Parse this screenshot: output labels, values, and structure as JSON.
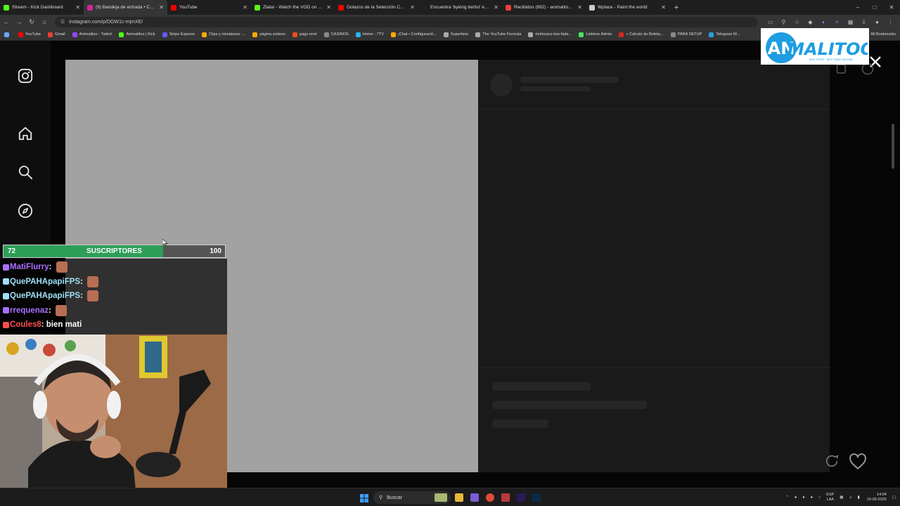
{
  "browser": {
    "tabs": [
      {
        "title": "Stream - Kick Dashboard",
        "color": "#53fc18",
        "active": false
      },
      {
        "title": "(9) Bandeja de entrada • Chats",
        "color": "#d6249f",
        "active": true
      },
      {
        "title": "YouTube",
        "color": "#ff0000",
        "active": false
      },
      {
        "title": "Zlatar - Watch the VOD on Kick",
        "color": "#53fc18",
        "active": false
      },
      {
        "title": "Golazos de la Selección Chilena",
        "color": "#ff0000",
        "active": false
      },
      {
        "title": "Encuentra 'byking tierlist' en TikTok",
        "color": "#222222",
        "active": false
      },
      {
        "title": "Recibidos (892) - animalitoo.stream",
        "color": "#ea4335",
        "active": false
      },
      {
        "title": "Wplace - Paint the world",
        "color": "#cccccc",
        "active": false
      }
    ],
    "new_tab": "+",
    "url": "instagram.com/p/DOW1c-mjmXE/",
    "bookmarks": [
      {
        "label": "YouTube",
        "color": "#ff0000"
      },
      {
        "label": "Gmail",
        "color": "#ea4335"
      },
      {
        "label": "Animalitoo - Twitch",
        "color": "#9146ff"
      },
      {
        "label": "Animalitoo | Kick",
        "color": "#53fc18"
      },
      {
        "label": "Stripe Express",
        "color": "#635bff"
      },
      {
        "label": "Clips y miniaturas -...",
        "color": "#f9ab00"
      },
      {
        "label": "página sorteos",
        "color": "#f9ab00"
      },
      {
        "label": "pago enel",
        "color": "#e94e1b"
      },
      {
        "label": "CASINOS",
        "color": "#8a8a8a"
      },
      {
        "label": "Home - 7TV",
        "color": "#29b6f6"
      },
      {
        "label": "¡Chat • Configuració...",
        "color": "#f9ab00"
      },
      {
        "label": "Superfans",
        "color": "#aaaaaa"
      },
      {
        "label": "The YouTube Formula",
        "color": "#aaaaaa"
      },
      {
        "label": "mohicano-low-fade...",
        "color": "#aaaaaa"
      },
      {
        "label": "Linktree Admin",
        "color": "#43e55e"
      },
      {
        "label": "« Calculo de Boleta...",
        "color": "#d52b1e"
      },
      {
        "label": "PARA SETUP",
        "color": "#8a8a8a"
      },
      {
        "label": "Telegram W...",
        "color": "#2aa1da"
      }
    ],
    "all_bookmarks": "All Bookmarks"
  },
  "logo": {
    "text": "ANIMALITOO",
    "tagline": "BEST SPORT · BEST DEAD GROUND"
  },
  "subscriber_goal": {
    "current": "72",
    "label": "SUSCRIPTORES",
    "goal": "100",
    "progress": 0.72
  },
  "chat": [
    {
      "user": "MatiFlurry",
      "color": "#a970ff",
      "message": "",
      "emote": true
    },
    {
      "user": "QuePAHApapiFPS",
      "color": "#9ee0f5",
      "message": "",
      "emote": true
    },
    {
      "user": "QuePAHApapiFPS",
      "color": "#9ee0f5",
      "message": "",
      "emote": true
    },
    {
      "user": "rrequenaz",
      "color": "#a970ff",
      "message": "",
      "emote": true
    },
    {
      "user": "Coules8",
      "color": "#ff4d4d",
      "message": "bien mati",
      "emote": false
    }
  ],
  "taskbar": {
    "search_placeholder": "Buscar",
    "lang_top": "ESP",
    "lang_bottom": "LAA",
    "time": "14:04",
    "date": "10-09-2025"
  },
  "icons": [
    "instagram-icon",
    "home-icon",
    "search-icon",
    "explore-icon",
    "close-icon",
    "heart-icon",
    "windows-start-icon"
  ]
}
